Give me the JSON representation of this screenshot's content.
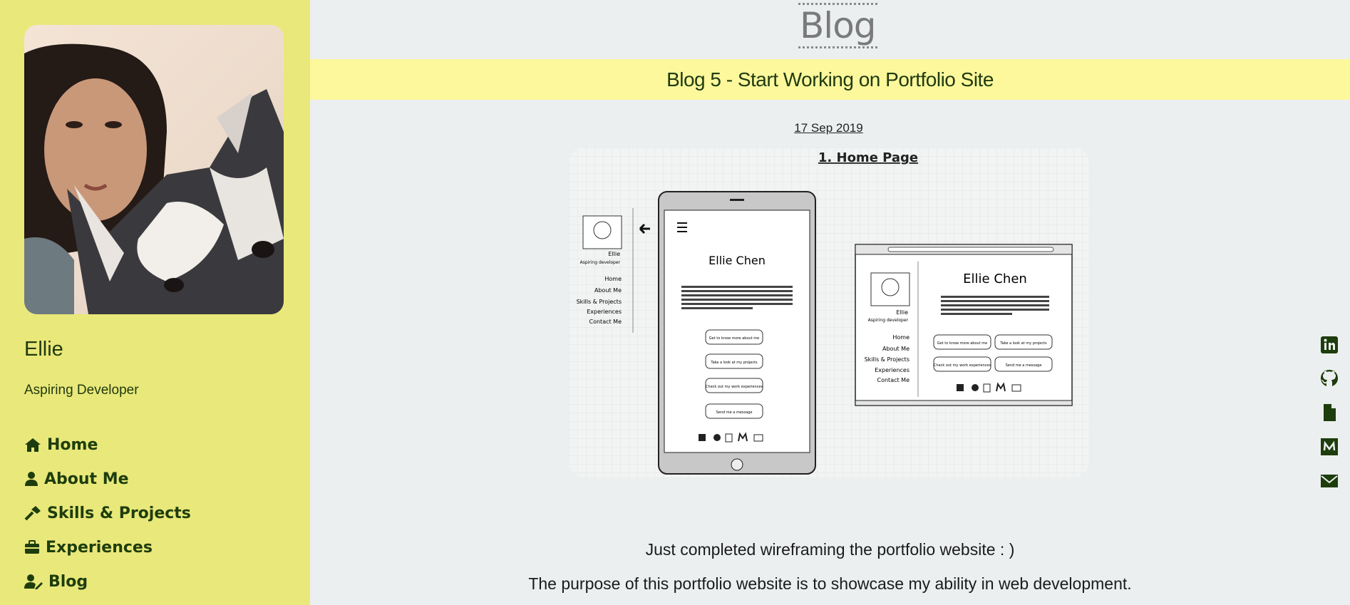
{
  "sidebar": {
    "name": "Ellie",
    "role": "Aspiring Developer",
    "nav": [
      {
        "label": "Home",
        "icon": "home-icon"
      },
      {
        "label": "About Me",
        "icon": "user-icon"
      },
      {
        "label": "Skills & Projects",
        "icon": "hammer-icon"
      },
      {
        "label": "Experiences",
        "icon": "briefcase-icon"
      },
      {
        "label": "Blog",
        "icon": "user-edit-icon"
      }
    ]
  },
  "page": {
    "title": "Blog"
  },
  "post": {
    "title": "Blog 5 - Start Working on Portfolio Site",
    "date": "17 Sep 2019",
    "paragraphs": [
      "Just completed wireframing the portfolio website : )",
      "The purpose of this portfolio website is to showcase my ability in web development."
    ]
  },
  "wireframe": {
    "heading": "1. Home Page",
    "side_name": "Ellie",
    "side_role": "Aspiring developer",
    "nav": [
      "Home",
      "About Me",
      "Skills & Projects",
      "Experiences",
      "Contact Me"
    ],
    "site_name": "Ellie Chen",
    "buttons": [
      "Get to know more about me",
      "Take a look at my projects",
      "Check out my work experiences",
      "Send me a message"
    ]
  },
  "social_icons": [
    "linkedin-icon",
    "github-icon",
    "resume-icon",
    "medium-icon",
    "email-icon"
  ],
  "colors": {
    "sidebar_bg": "#e9e87a",
    "banner_bg": "#fdf89c",
    "accent_dark_green": "#1d3d0c",
    "page_bg": "#eceff0"
  }
}
